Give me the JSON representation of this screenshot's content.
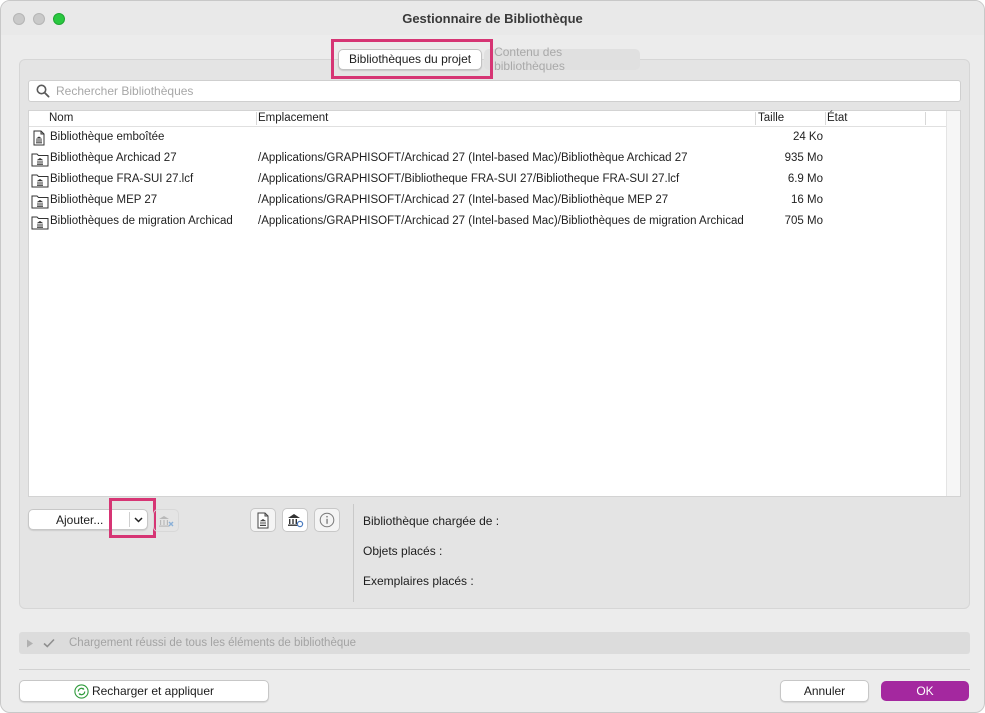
{
  "window": {
    "title": "Gestionnaire de Bibliothèque"
  },
  "tabs": [
    {
      "label": "Bibliothèques du projet",
      "active": true
    },
    {
      "label": "Contenu des bibliothèques",
      "active": false
    }
  ],
  "search": {
    "placeholder": "Rechercher Bibliothèques",
    "value": ""
  },
  "table": {
    "headers": {
      "name": "Nom",
      "location": "Emplacement",
      "size": "Taille",
      "state": "État"
    },
    "rows": [
      {
        "icon": "library-file-icon",
        "name": "Bibliothèque emboîtée",
        "location": "",
        "size": "24 Ko",
        "state": ""
      },
      {
        "icon": "library-folder-icon",
        "name": "Bibliothèque Archicad 27",
        "location": "/Applications/GRAPHISOFT/Archicad 27 (Intel-based Mac)/Bibliothèque Archicad 27",
        "size": "935 Mo",
        "state": ""
      },
      {
        "icon": "library-folder-icon",
        "name": "Bibliotheque FRA-SUI 27.lcf",
        "location": "/Applications/GRAPHISOFT/Bibliotheque FRA-SUI 27/Bibliotheque FRA-SUI 27.lcf",
        "size": "6.9 Mo",
        "state": ""
      },
      {
        "icon": "library-folder-icon",
        "name": "Bibliothèque MEP 27",
        "location": "/Applications/GRAPHISOFT/Archicad 27 (Intel-based Mac)/Bibliothèque MEP 27",
        "size": "16 Mo",
        "state": ""
      },
      {
        "icon": "library-folder-icon",
        "name": "Bibliothèques de migration Archicad",
        "location": "/Applications/GRAPHISOFT/Archicad 27 (Intel-based Mac)/Bibliothèques de migration Archicad",
        "size": "705 Mo",
        "state": ""
      }
    ]
  },
  "controls": {
    "add_label": "Ajouter..."
  },
  "info": {
    "loaded_from": "Bibliothèque chargée de :",
    "placed_objects": "Objets placés :",
    "placed_instances": "Exemplaires placés :"
  },
  "status": {
    "message": "Chargement réussi de tous les éléments de bibliothèque"
  },
  "footer": {
    "reload_label": "Recharger et appliquer",
    "cancel_label": "Annuler",
    "ok_label": "OK"
  },
  "colors": {
    "accent": "#a4289f",
    "highlight": "#d63574",
    "traffic_green": "#2ac840"
  }
}
